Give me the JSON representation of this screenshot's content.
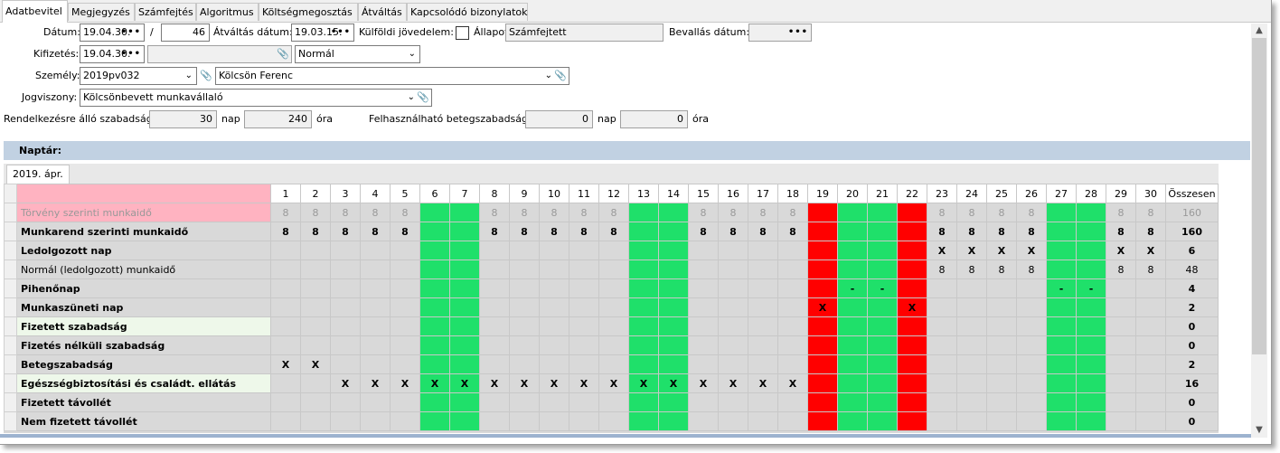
{
  "tabs": [
    {
      "label": "Adatbevitel",
      "active": true
    },
    {
      "label": "Megjegyzés"
    },
    {
      "label": "Számfejtés"
    },
    {
      "label": "Algoritmus"
    },
    {
      "label": "Költségmegosztás"
    },
    {
      "label": "Átváltás"
    },
    {
      "label": "Kapcsolódó bizonylatok"
    }
  ],
  "form": {
    "datum_label": "Dátum:",
    "datum_value": "19.04.30.",
    "slash": "/",
    "datum_num": "46",
    "atvaltas_label": "Átváltás dátum:",
    "atvaltas_value": "19.03.15.",
    "kulfoldi_label": "Külföldi jövedelem:",
    "allapot_label": "Állapot:",
    "allapot_value": "Számfejtett",
    "bevallas_label": "Bevallás dátum:",
    "bevallas_value": "",
    "kifizetes_label": "Kifizetés:",
    "kifizetes_value": "19.04.30.",
    "kifizetes_extra": "",
    "kifizetes_type": "Normál",
    "szemely_label": "Személy:",
    "szemely_code": "2019pv032",
    "szemely_name": "Kölcsön Ferenc",
    "jogviszony_label": "Jogviszony:",
    "jogviszony_value": "Kölcsönbevett munkavállaló",
    "szabadsag_label": "Rendelkezésre álló szabadság:",
    "szabadsag_nap": "30",
    "nap_label": "nap",
    "szabadsag_ora": "240",
    "ora_label": "óra",
    "beteg_label": "Felhasználható betegszabadság:",
    "beteg_nap": "0",
    "beteg_ora": "0"
  },
  "icons": {
    "dots": "•••",
    "chevron": "chevron-down-icon",
    "clip": "paperclip-icon"
  },
  "calendar": {
    "section_title": "Naptár:",
    "month_tab": "2019. ápr.",
    "days": [
      "1",
      "2",
      "3",
      "4",
      "5",
      "6",
      "7",
      "8",
      "9",
      "10",
      "11",
      "12",
      "13",
      "14",
      "15",
      "16",
      "17",
      "18",
      "19",
      "20",
      "21",
      "22",
      "23",
      "24",
      "25",
      "26",
      "27",
      "28",
      "29",
      "30"
    ],
    "total_header": "Összesen",
    "day_colors": [
      "",
      "",
      "",
      "",
      "",
      "g",
      "g",
      "",
      "",
      "",
      "",
      "",
      "g",
      "g",
      "",
      "",
      "",
      "",
      "r",
      "g",
      "g",
      "r",
      "",
      "",
      "",
      "",
      "g",
      "g",
      "",
      ""
    ],
    "rows": [
      {
        "name": "Törvény szerinti munkaidő",
        "style": "pink",
        "cells": [
          "8",
          "8",
          "8",
          "8",
          "8",
          "",
          "",
          "8",
          "8",
          "8",
          "8",
          "8",
          "",
          "",
          "8",
          "8",
          "8",
          "8",
          "",
          "",
          "",
          "",
          "8",
          "8",
          "8",
          "8",
          "",
          "",
          "8",
          "8"
        ],
        "total": "160"
      },
      {
        "name": "Munkarend szerinti munkaidő",
        "style": "bold",
        "cells": [
          "8",
          "8",
          "8",
          "8",
          "8",
          "",
          "",
          "8",
          "8",
          "8",
          "8",
          "8",
          "",
          "",
          "8",
          "8",
          "8",
          "8",
          "",
          "",
          "",
          "",
          "8",
          "8",
          "8",
          "8",
          "",
          "",
          "8",
          "8"
        ],
        "total": "160"
      },
      {
        "name": "Ledolgozott nap",
        "style": "bold",
        "cells": [
          "",
          "",
          "",
          "",
          "",
          "",
          "",
          "",
          "",
          "",
          "",
          "",
          "",
          "",
          "",
          "",
          "",
          "",
          "",
          "",
          "",
          "",
          "X",
          "X",
          "X",
          "X",
          "",
          "",
          "X",
          "X"
        ],
        "total": "6"
      },
      {
        "name": "Normál (ledolgozott) munkaidő",
        "style": "norm",
        "cells": [
          "",
          "",
          "",
          "",
          "",
          "",
          "",
          "",
          "",
          "",
          "",
          "",
          "",
          "",
          "",
          "",
          "",
          "",
          "",
          "",
          "",
          "",
          "8",
          "8",
          "8",
          "8",
          "",
          "",
          "8",
          "8"
        ],
        "total": "48"
      },
      {
        "name": "Pihenőnap",
        "style": "bold",
        "cells": [
          "",
          "",
          "",
          "",
          "",
          "",
          "",
          "",
          "",
          "",
          "",
          "",
          "",
          "",
          "",
          "",
          "",
          "",
          "",
          "-",
          "-",
          "",
          "",
          "",
          "",
          "",
          "-",
          "-",
          "",
          ""
        ],
        "total": "4"
      },
      {
        "name": "Munkaszüneti nap",
        "style": "bold",
        "cells": [
          "",
          "",
          "",
          "",
          "",
          "",
          "",
          "",
          "",
          "",
          "",
          "",
          "",
          "",
          "",
          "",
          "",
          "",
          "X",
          "",
          "",
          "X",
          "",
          "",
          "",
          "",
          "",
          "",
          "",
          ""
        ],
        "total": "2"
      },
      {
        "name": "Fizetett szabadság",
        "style": "green",
        "cells": [
          "",
          "",
          "",
          "",
          "",
          "",
          "",
          "",
          "",
          "",
          "",
          "",
          "",
          "",
          "",
          "",
          "",
          "",
          "",
          "",
          "",
          "",
          "",
          "",
          "",
          "",
          "",
          "",
          "",
          ""
        ],
        "total": "0"
      },
      {
        "name": "Fizetés nélküli szabadság",
        "style": "bold",
        "cells": [
          "",
          "",
          "",
          "",
          "",
          "",
          "",
          "",
          "",
          "",
          "",
          "",
          "",
          "",
          "",
          "",
          "",
          "",
          "",
          "",
          "",
          "",
          "",
          "",
          "",
          "",
          "",
          "",
          "",
          ""
        ],
        "total": "0"
      },
      {
        "name": "Betegszabadság",
        "style": "bold",
        "cells": [
          "X",
          "X",
          "",
          "",
          "",
          "",
          "",
          "",
          "",
          "",
          "",
          "",
          "",
          "",
          "",
          "",
          "",
          "",
          "",
          "",
          "",
          "",
          "",
          "",
          "",
          "",
          "",
          "",
          "",
          ""
        ],
        "total": "2"
      },
      {
        "name": "Egészségbiztosítási és családt. ellátás",
        "style": "green",
        "cells": [
          "",
          "",
          "X",
          "X",
          "X",
          "X",
          "X",
          "X",
          "X",
          "X",
          "X",
          "X",
          "X",
          "X",
          "X",
          "X",
          "X",
          "X",
          "",
          "",
          "",
          "",
          "",
          "",
          "",
          "",
          "",
          "",
          "",
          ""
        ],
        "total": "16"
      },
      {
        "name": "Fizetett távollét",
        "style": "bold",
        "cells": [
          "",
          "",
          "",
          "",
          "",
          "",
          "",
          "",
          "",
          "",
          "",
          "",
          "",
          "",
          "",
          "",
          "",
          "",
          "",
          "",
          "",
          "",
          "",
          "",
          "",
          "",
          "",
          "",
          "",
          ""
        ],
        "total": "0"
      },
      {
        "name": "Nem fizetett távollét",
        "style": "bold",
        "cells": [
          "",
          "",
          "",
          "",
          "",
          "",
          "",
          "",
          "",
          "",
          "",
          "",
          "",
          "",
          "",
          "",
          "",
          "",
          "",
          "",
          "",
          "",
          "",
          "",
          "",
          "",
          "",
          "",
          "",
          ""
        ],
        "total": "0"
      }
    ]
  }
}
